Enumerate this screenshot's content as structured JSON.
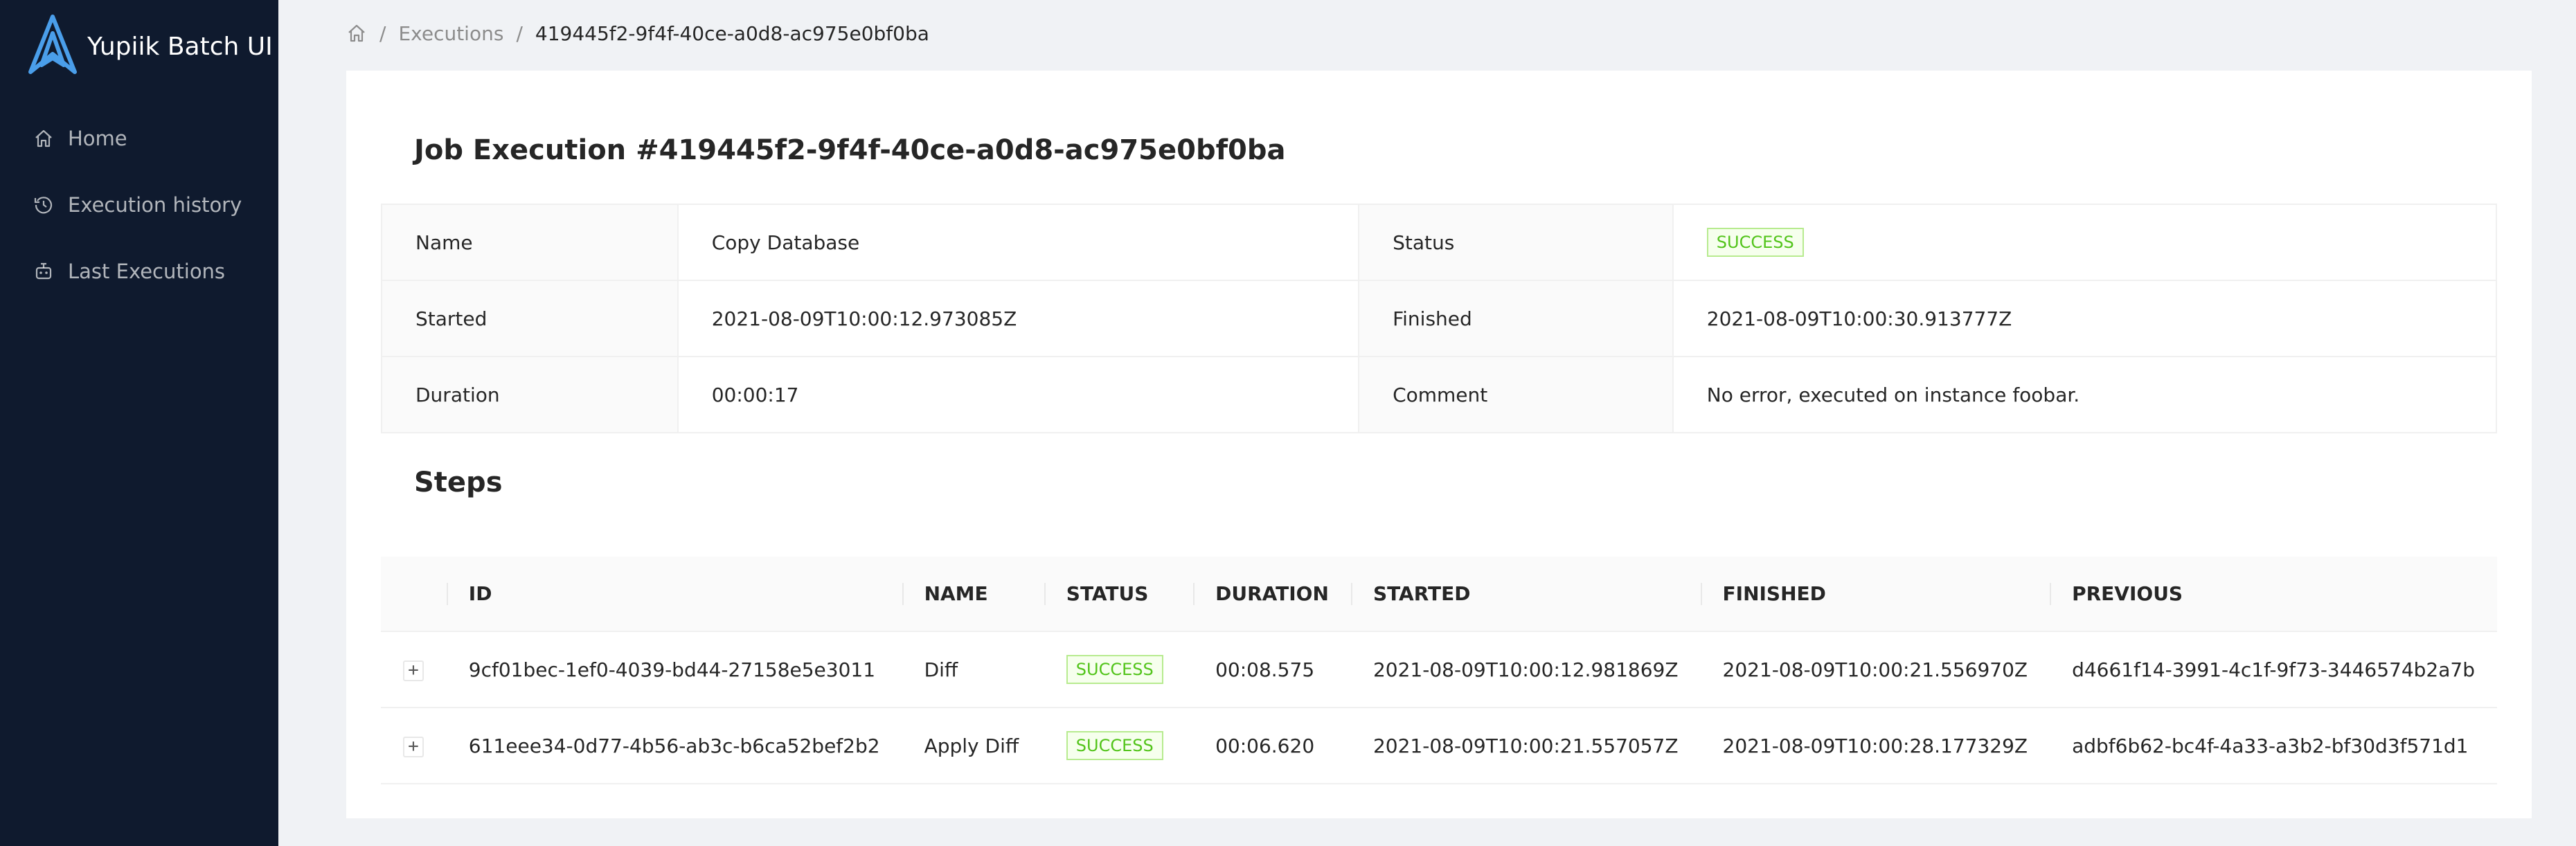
{
  "app": {
    "title": "Yupiik Batch UI",
    "colors": {
      "sidebar": "#0f1a2e",
      "accent": "#1890ff",
      "success": "#52c41a"
    }
  },
  "sidebar": {
    "items": [
      {
        "label": "Home",
        "icon": "home-icon"
      },
      {
        "label": "Execution history",
        "icon": "history-icon"
      },
      {
        "label": "Last Executions",
        "icon": "robot-icon"
      }
    ]
  },
  "breadcrumb": {
    "home_icon": "home-icon",
    "items": [
      "Executions",
      "419445f2-9f4f-40ce-a0d8-ac975e0bf0ba"
    ]
  },
  "job": {
    "title": "Job Execution #419445f2-9f4f-40ce-a0d8-ac975e0bf0ba",
    "fields": {
      "name_label": "Name",
      "name": "Copy Database",
      "status_label": "Status",
      "status": "SUCCESS",
      "started_label": "Started",
      "started": "2021-08-09T10:00:12.973085Z",
      "finished_label": "Finished",
      "finished": "2021-08-09T10:00:30.913777Z",
      "duration_label": "Duration",
      "duration": "00:00:17",
      "comment_label": "Comment",
      "comment": "No error, executed on instance foobar."
    }
  },
  "steps": {
    "title": "Steps",
    "columns": [
      "ID",
      "NAME",
      "STATUS",
      "DURATION",
      "STARTED",
      "FINISHED",
      "PREVIOUS"
    ],
    "expand_symbol": "+",
    "rows": [
      {
        "id": "9cf01bec-1ef0-4039-bd44-27158e5e3011",
        "name": "Diff",
        "status": "SUCCESS",
        "duration": "00:08.575",
        "started": "2021-08-09T10:00:12.981869Z",
        "finished": "2021-08-09T10:00:21.556970Z",
        "previous": "d4661f14-3991-4c1f-9f73-3446574b2a7b"
      },
      {
        "id": "611eee34-0d77-4b56-ab3c-b6ca52bef2b2",
        "name": "Apply Diff",
        "status": "SUCCESS",
        "duration": "00:06.620",
        "started": "2021-08-09T10:00:21.557057Z",
        "finished": "2021-08-09T10:00:28.177329Z",
        "previous": "adbf6b62-bc4f-4a33-a3b2-bf30d3f571d1"
      }
    ]
  }
}
